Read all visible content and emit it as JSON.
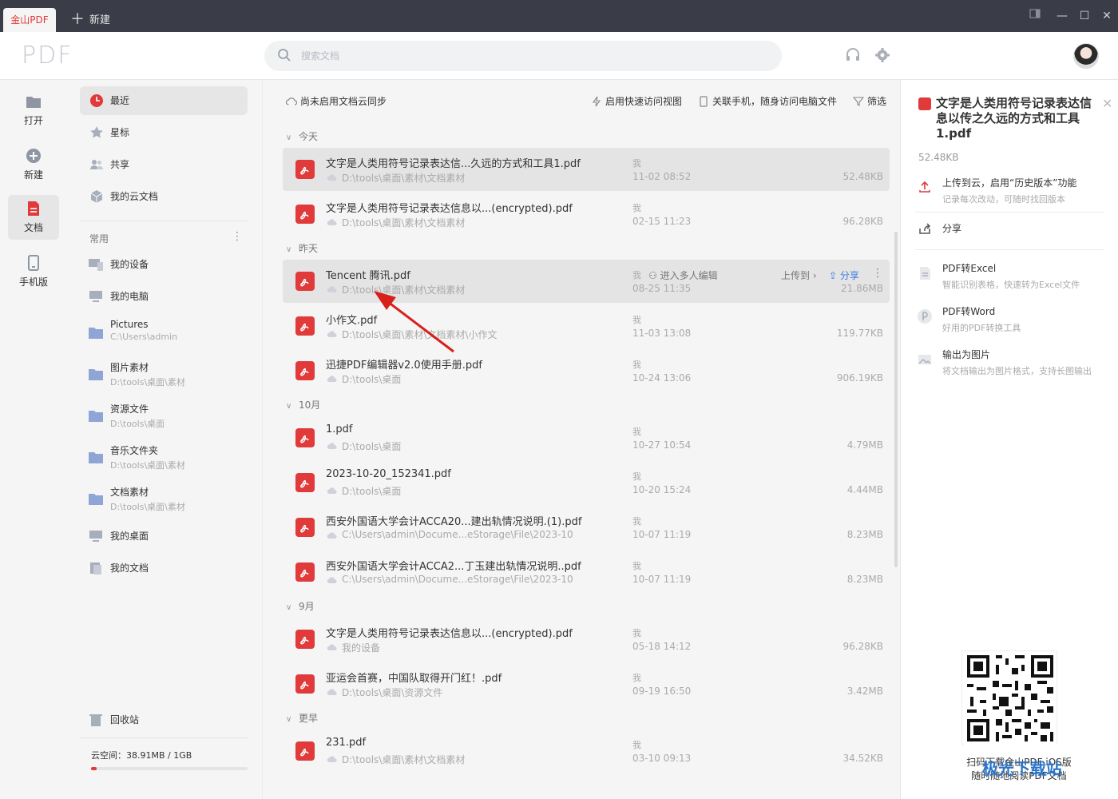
{
  "titlebar": {
    "app_tab": "金山PDF",
    "new_tab": "新建"
  },
  "header": {
    "logo": "PDF",
    "search_placeholder": "搜索文档"
  },
  "rail": [
    {
      "label": "打开",
      "icon": "folder-icon"
    },
    {
      "label": "新建",
      "icon": "plus-circle-icon"
    },
    {
      "label": "文档",
      "icon": "document-icon"
    },
    {
      "label": "手机版",
      "icon": "phone-icon"
    }
  ],
  "nav": {
    "items": [
      {
        "label": "最近",
        "icon": "clock-icon"
      },
      {
        "label": "星标",
        "icon": "star-icon"
      },
      {
        "label": "共享",
        "icon": "people-icon"
      },
      {
        "label": "我的云文档",
        "icon": "cloud-box-icon"
      }
    ],
    "section": "常用",
    "locations": [
      {
        "label": "我的设备",
        "sub": ""
      },
      {
        "label": "我的电脑",
        "sub": ""
      },
      {
        "label": "Pictures",
        "sub": "C:\\Users\\admin"
      },
      {
        "label": "图片素材",
        "sub": "D:\\tools\\桌面\\素材"
      },
      {
        "label": "资源文件",
        "sub": "D:\\tools\\桌面"
      },
      {
        "label": "音乐文件夹",
        "sub": "D:\\tools\\桌面\\素材"
      },
      {
        "label": "文档素材",
        "sub": "D:\\tools\\桌面\\素材"
      },
      {
        "label": "我的桌面",
        "sub": ""
      },
      {
        "label": "我的文档",
        "sub": ""
      }
    ],
    "recycle": "回收站",
    "cloud_space": "云空间：38.91MB / 1GB",
    "cloud_space_fraction": 0.038
  },
  "toolbar": {
    "sync": "尚未启用文档云同步",
    "quick_view": "启用快速访问视图",
    "phone": "关联手机，随身访问电脑文件",
    "filter": "筛选"
  },
  "groups": {
    "today": "今天",
    "yesterday": "昨天",
    "october": "10月",
    "september": "9月",
    "earlier": "更早"
  },
  "files": [
    {
      "name": "文字是人类用符号记录表达信...久远的方式和工具1.pdf",
      "path": "D:\\tools\\桌面\\素材\\文档素材",
      "owner": "我",
      "date": "11-02 08:52",
      "size": "52.48KB"
    },
    {
      "name": "文字是人类用符号记录表达信息以...(encrypted).pdf",
      "path": "D:\\tools\\桌面\\素材\\文档素材",
      "owner": "我",
      "date": "02-15 11:23",
      "size": "96.28KB"
    },
    {
      "name": "Tencent 腾讯.pdf",
      "path": "D:\\tools\\桌面\\素材\\文档素材",
      "owner": "我",
      "date": "08-25 11:35",
      "size": "21.86MB",
      "collab": "进入多人编辑",
      "upload": "上传到 ›",
      "share": "分享"
    },
    {
      "name": "小作文.pdf",
      "path": "D:\\tools\\桌面\\素材\\文档素材\\小作文",
      "owner": "我",
      "date": "11-03 13:08",
      "size": "119.77KB"
    },
    {
      "name": "迅捷PDF编辑器v2.0使用手册.pdf",
      "path": "D:\\tools\\桌面",
      "owner": "我",
      "date": "10-24 13:06",
      "size": "906.19KB"
    },
    {
      "name": "1.pdf",
      "path": "D:\\tools\\桌面",
      "owner": "我",
      "date": "10-27 10:54",
      "size": "4.79MB"
    },
    {
      "name": "2023-10-20_152341.pdf",
      "path": "D:\\tools\\桌面",
      "owner": "我",
      "date": "10-20 15:24",
      "size": "4.44MB"
    },
    {
      "name": "西安外国语大学会计ACCA20...建出轨情况说明.(1).pdf",
      "path": "C:\\Users\\admin\\Docume...eStorage\\File\\2023-10",
      "owner": "我",
      "date": "10-07 11:19",
      "size": "8.23MB"
    },
    {
      "name": "西安外国语大学会计ACCA2...丁玉建出轨情况说明..pdf",
      "path": "C:\\Users\\admin\\Docume...eStorage\\File\\2023-10",
      "owner": "我",
      "date": "10-07 11:19",
      "size": "8.23MB"
    },
    {
      "name": "文字是人类用符号记录表达信息以...(encrypted).pdf",
      "path": "我的设备",
      "owner": "我",
      "date": "05-18 14:12",
      "size": "96.28KB"
    },
    {
      "name": "亚运会首赛，中国队取得开门红！.pdf",
      "path": "D:\\tools\\桌面\\资源文件",
      "owner": "我",
      "date": "09-19 16:50",
      "size": "3.42MB"
    },
    {
      "name": "231.pdf",
      "path": "D:\\tools\\桌面\\素材\\文档素材",
      "owner": "我",
      "date": "03-10 09:13",
      "size": "34.52KB"
    }
  ],
  "panel": {
    "title": "文字是人类用符号记录表达信息以传之久远的方式和工具1.pdf",
    "size": "52.48KB",
    "upload_title": "上传到云，启用“历史版本”功能",
    "upload_sub": "记录每次改动，可随时找回版本",
    "share": "分享",
    "tools": [
      {
        "title": "PDF转Excel",
        "sub": "智能识别表格，快速转为Excel文件"
      },
      {
        "title": "PDF转Word",
        "sub": "好用的PDF转换工具"
      },
      {
        "title": "输出为图片",
        "sub": "将文档输出为图片格式，支持长图输出"
      }
    ],
    "qr_caption_1": "扫码下载金山PDF iOS版",
    "qr_caption_2": "随时随地阅读PDF文档"
  },
  "watermark": "极光下载站",
  "colors": {
    "accent": "#e03a3a",
    "link": "#3b7be0",
    "titlebar": "#3a3d47"
  }
}
